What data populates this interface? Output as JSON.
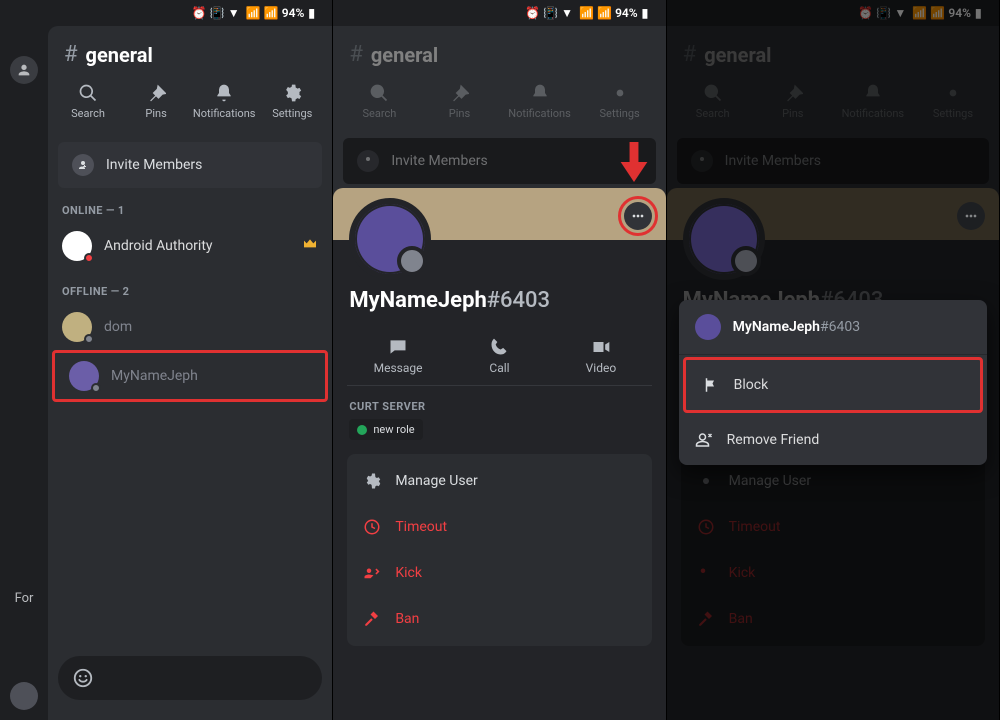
{
  "statusbar": {
    "battery_pct": "94%"
  },
  "channel": {
    "name": "general"
  },
  "toolbar": {
    "search": "Search",
    "pins": "Pins",
    "notifications": "Notifications",
    "settings": "Settings"
  },
  "invite_label": "Invite Members",
  "sections": {
    "online": "ONLINE — 1",
    "offline": "OFFLINE — 2"
  },
  "members": {
    "m0": {
      "name": "Android Authority"
    },
    "m1": {
      "name": "dom"
    },
    "m2": {
      "name": "MyNameJeph"
    }
  },
  "left_rail": {
    "for_label": "For"
  },
  "profile": {
    "username": "MyNameJeph",
    "discriminator": "#6403",
    "actions": {
      "message": "Message",
      "call": "Call",
      "video": "Video"
    },
    "server_label": "CURT SERVER",
    "role": "new role",
    "card": {
      "manage": "Manage User",
      "timeout": "Timeout",
      "kick": "Kick",
      "ban": "Ban"
    }
  },
  "context": {
    "username": "MyNameJeph",
    "discriminator": "#6403",
    "block": "Block",
    "remove": "Remove Friend"
  }
}
